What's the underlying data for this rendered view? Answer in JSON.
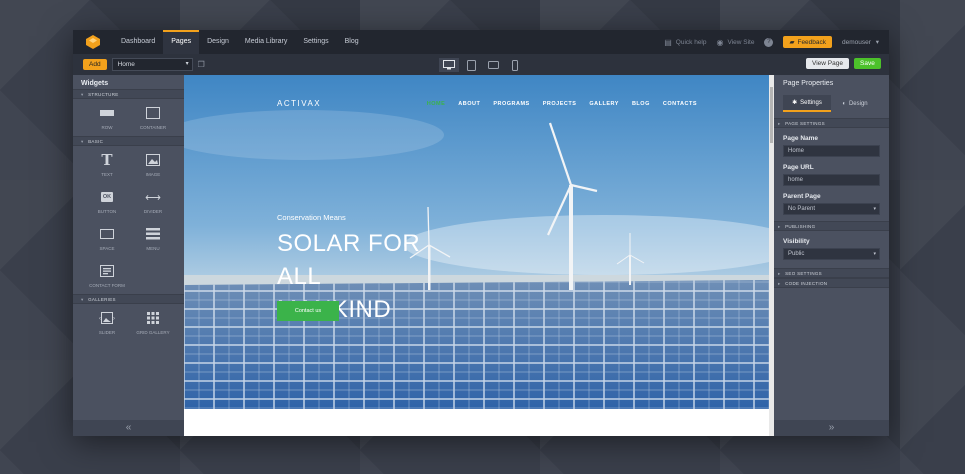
{
  "topbar": {
    "nav": [
      "Dashboard",
      "Pages",
      "Design",
      "Media Library",
      "Settings",
      "Blog"
    ],
    "active_nav": "Pages",
    "quick_help": "Quick help",
    "view_site": "View Site",
    "help_icon": "?",
    "feedback": "Feedback",
    "user": "demouser"
  },
  "toolbar": {
    "add_label": "Add",
    "page_select_value": "Home",
    "view_page": "View Page",
    "save": "Save",
    "devices": [
      "desktop-icon",
      "tablet-portrait-icon",
      "tablet-landscape-icon",
      "phone-icon"
    ]
  },
  "left_panel": {
    "title": "Widgets",
    "sections": [
      {
        "name": "STRUCTURE",
        "items": [
          "ROW",
          "CONTAINER"
        ]
      },
      {
        "name": "BASIC",
        "items": [
          "TEXT",
          "IMAGE",
          "BUTTON",
          "DIVIDER",
          "SPACE",
          "MENU",
          "CONTACT FORM"
        ]
      },
      {
        "name": "GALLERIES",
        "items": [
          "SLIDER",
          "GRID GALLERY"
        ]
      }
    ],
    "collapse": "«"
  },
  "canvas": {
    "logo": "ACTIVAX",
    "menu": [
      "HOME",
      "ABOUT",
      "PROGRAMS",
      "PROJECTS",
      "GALLERY",
      "BLOG",
      "CONTACTS"
    ],
    "hero_sub": "Conservation Means",
    "hero_title_line1": "SOLAR FOR ALL",
    "hero_title_line2": "MANKIND",
    "cta": "Contact us"
  },
  "right_panel": {
    "title": "Page Properties",
    "tabs": [
      "Settings",
      "Design"
    ],
    "sections": {
      "page_settings": "PAGE SETTINGS",
      "publishing": "PUBLISHING",
      "seo": "SEO SETTINGS",
      "code": "CODE INJECTION"
    },
    "page_name_label": "Page Name",
    "page_name_value": "Home",
    "page_url_label": "Page URL",
    "page_url_value": "home",
    "parent_label": "Parent Page",
    "parent_value": "No Parent",
    "visibility_label": "Visibility",
    "visibility_value": "Public",
    "collapse": "»"
  },
  "colors": {
    "accent": "#f2a11c",
    "save": "#4cc12a",
    "site_green": "#3bb34a"
  }
}
